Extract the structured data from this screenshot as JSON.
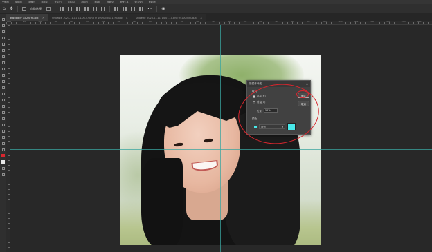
{
  "menubar": [
    "文件(F)",
    "编辑(E)",
    "图像(I)",
    "图层(L)",
    "文字(Y)",
    "选择(S)",
    "滤镜(T)",
    "3D(D)",
    "视图(V)",
    "增效工具",
    "窗口(W)",
    "帮助(H)"
  ],
  "options_bar": {
    "auto_select_label": "自动选择:",
    "more_label": "•••"
  },
  "tabs": [
    {
      "label": "图像.jpg @ 73.2%(RGB/8)",
      "active": true
    },
    {
      "label": "Snipaste_2023-11-11_14-06-47.png @ 100% (图层 1, RGB/8)",
      "active": false
    },
    {
      "label": "Snipaste_2023-11-11_14-07-10.png @ 100%(RGB/8)",
      "active": false
    }
  ],
  "ruler_labels": [
    "1000",
    "900",
    "800",
    "700",
    "600",
    "500",
    "400",
    "300",
    "200",
    "100",
    "0",
    "100",
    "200",
    "300",
    "400",
    "500",
    "600",
    "700",
    "800",
    "900",
    "1000",
    "1100",
    "1200",
    "1300",
    "1400",
    "1500",
    "1600"
  ],
  "dialog": {
    "title": "新建参考线",
    "orientation_label": "取向",
    "option_horizontal": "水平(H)",
    "option_vertical": "垂直(V)",
    "position_label": "位置:",
    "position_value": "50%",
    "ok_label": "确定",
    "cancel_label": "取消",
    "color_label": "颜色",
    "color_value": "青色",
    "guide_color": "#48e8e9"
  },
  "colors": {
    "annotation": "#d8262e",
    "guide_line": "#3aa6a0"
  }
}
